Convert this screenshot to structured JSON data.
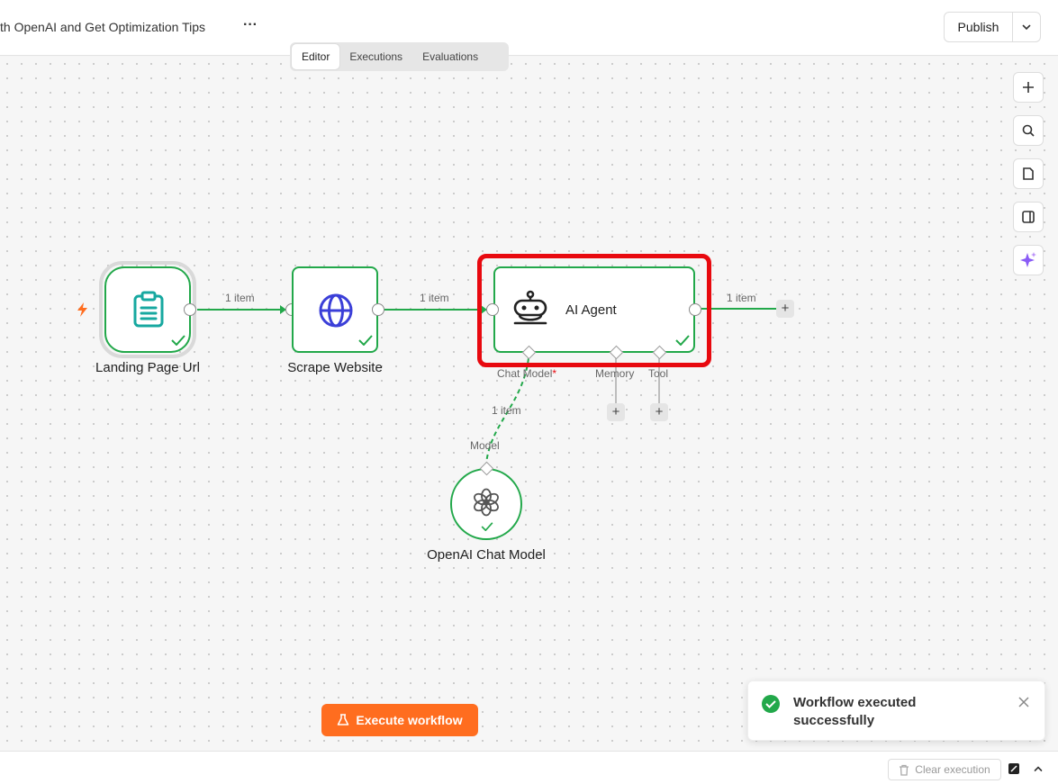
{
  "header": {
    "workflow_title": "th OpenAI and Get Optimization Tips",
    "more_label": "···",
    "publish_label": "Publish"
  },
  "tabs": [
    {
      "label": "Editor",
      "active": true
    },
    {
      "label": "Executions",
      "active": false
    },
    {
      "label": "Evaluations",
      "active": false
    }
  ],
  "nodes": {
    "landing": {
      "label": "Landing Page Url",
      "icon": "clipboard-icon"
    },
    "scrape": {
      "label": "Scrape Website",
      "icon": "globe-icon"
    },
    "agent": {
      "label": "AI Agent",
      "icon": "robot-icon"
    },
    "openai": {
      "label": "OpenAI Chat Model",
      "icon": "openai-icon"
    }
  },
  "edges": {
    "e1": "1 item",
    "e2": "1 item",
    "e3": "1 item",
    "e4": "1 item"
  },
  "ports": {
    "chat_model": "Chat Model",
    "chat_model_required": "*",
    "memory": "Memory",
    "tool": "Tool",
    "model": "Model"
  },
  "colors": {
    "success": "#22a84a",
    "accent": "#ff6d1f",
    "highlight": "#e8090f",
    "globe": "#3b3fd8",
    "clipboard": "#17a8a0"
  },
  "execute_label": "Execute workflow",
  "toast": {
    "message": "Workflow executed successfully"
  },
  "footer": {
    "clear_label": "Clear execution"
  }
}
